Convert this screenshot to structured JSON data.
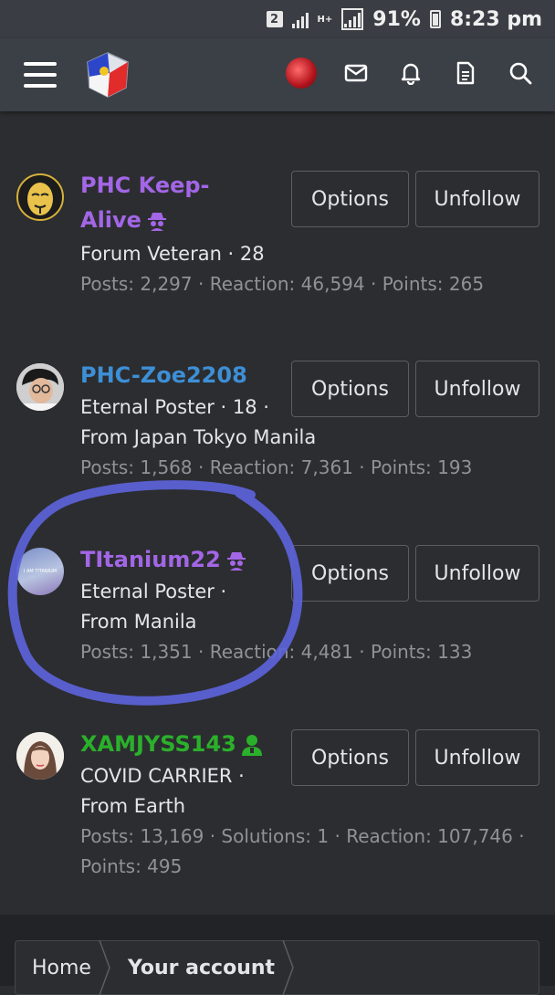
{
  "status_bar": {
    "sim": "2",
    "network": "H+",
    "battery": "91%",
    "time": "8:23 pm"
  },
  "nav": {
    "icons": [
      "menu-icon",
      "site-logo",
      "user-avatar",
      "mail-icon",
      "bell-icon",
      "document-icon",
      "search-icon"
    ]
  },
  "members": [
    {
      "name_lines": [
        "PHC Keep-",
        "Alive"
      ],
      "name_color": "#a266e6",
      "badge": "spy-icon",
      "lines": [
        "Forum Veteran · 28"
      ],
      "stats": [
        "Posts: 2,297 · Reaction: 46,594 · Points: 265"
      ],
      "options": "Options",
      "unfollow": "Unfollow"
    },
    {
      "name_lines": [
        "PHC-Zoe2208"
      ],
      "name_color": "#3d8fd6",
      "badge": "",
      "lines": [
        "Eternal Poster · 18 ·",
        "From Japan Tokyo Manila"
      ],
      "stats": [
        "Posts: 1,568 · Reaction: 7,361 · Points: 193"
      ],
      "options": "Options",
      "unfollow": "Unfollow"
    },
    {
      "name_lines": [
        "TItanium22"
      ],
      "name_color": "#a266e6",
      "badge": "spy-icon",
      "avatar_text": "I AM TITANIUM",
      "lines": [
        "Eternal Poster ·",
        "From Manila"
      ],
      "stats": [
        "Posts: 1,351 · Reaction: 4,481 · Points: 133"
      ],
      "options": "Options",
      "unfollow": "Unfollow"
    },
    {
      "name_lines": [
        "XAMJYSS143"
      ],
      "name_color": "#2bb02b",
      "badge": "user-icon",
      "lines": [
        "COVID CARRIER ·",
        "From Earth"
      ],
      "stats": [
        "Posts: 13,169 · Solutions: 1 · Reaction: 107,746 ·",
        "Points: 495"
      ],
      "options": "Options",
      "unfollow": "Unfollow"
    }
  ],
  "breadcrumb": {
    "home": "Home",
    "current": "Your account"
  },
  "colors": {
    "background": "#2c2d30",
    "header": "#3b3f46",
    "highlight_ring": "#5c63d9"
  }
}
